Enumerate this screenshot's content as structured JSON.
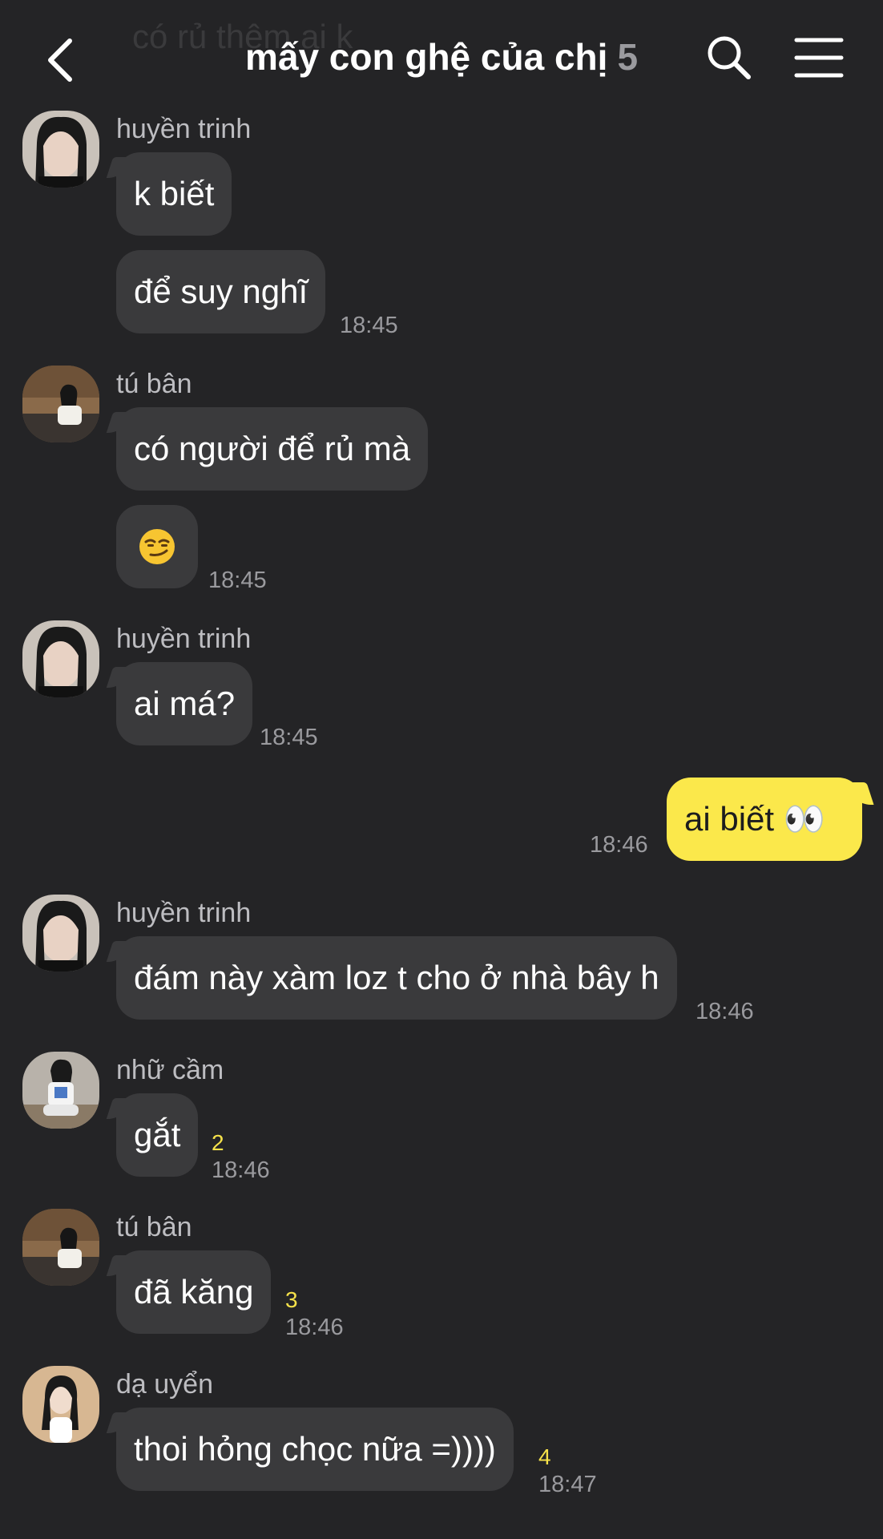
{
  "header": {
    "ghost_text": "có rủ thêm ai k",
    "title": "mấy con ghệ của chị",
    "member_count": "5"
  },
  "messages": [
    {
      "sender": "huyền trinh",
      "text": "k biết"
    },
    {
      "text": "để suy nghĩ",
      "time": "18:45"
    },
    {
      "sender": "tú bân",
      "text": "có người để rủ mà"
    },
    {
      "emoji": "smirking-face",
      "time": "18:45"
    },
    {
      "sender": "huyền trinh",
      "text": "ai má?",
      "time": "18:45"
    },
    {
      "mine": true,
      "text": "ai biết 👀",
      "time": "18:46"
    },
    {
      "sender": "huyền trinh",
      "text": "đám này xàm loz t cho ở nhà bây h",
      "time": "18:46"
    },
    {
      "sender": "nhữ cầm",
      "text": "gắt",
      "unread": "2",
      "time": "18:46"
    },
    {
      "sender": "tú bân",
      "text": "đã kăng",
      "unread": "3",
      "time": "18:46"
    },
    {
      "sender": "dạ uyển",
      "text": "thoi hỏng chọc nữa =))))",
      "unread": "4",
      "time": "18:47"
    }
  ],
  "colors": {
    "background": "#242426",
    "bubble_other": "#3a3a3c",
    "bubble_mine": "#fbe84b",
    "unread": "#f5e14a"
  }
}
